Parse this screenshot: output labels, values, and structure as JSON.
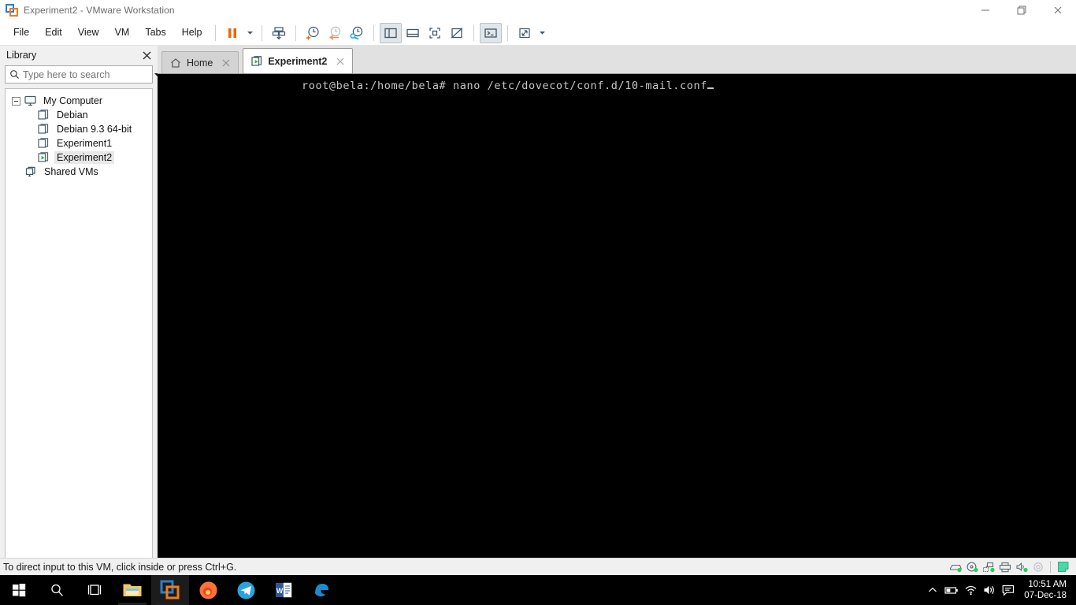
{
  "window": {
    "title": "Experiment2 - VMware Workstation",
    "app_icon": "vmware-logo-icon",
    "minimize_label": "Minimize",
    "restore_label": "Restore",
    "close_label": "Close"
  },
  "menubar": {
    "items": [
      {
        "label": "File",
        "name": "menu-file"
      },
      {
        "label": "Edit",
        "name": "menu-edit"
      },
      {
        "label": "View",
        "name": "menu-view"
      },
      {
        "label": "VM",
        "name": "menu-vm"
      },
      {
        "label": "Tabs",
        "name": "menu-tabs"
      },
      {
        "label": "Help",
        "name": "menu-help"
      }
    ]
  },
  "toolbar": {
    "buttons": [
      {
        "name": "suspend-button",
        "icon": "pause-icon",
        "tooltip": "Suspend this virtual machine"
      },
      {
        "name": "power-dropdown",
        "icon": "chevron-down-icon",
        "tooltip": "Power options"
      },
      {
        "name": "send-ctrl-alt-del-button",
        "icon": "send-keys-icon",
        "tooltip": "Send Ctrl+Alt+Delete"
      },
      {
        "name": "take-snapshot-button",
        "icon": "snapshot-add-icon",
        "tooltip": "Take a snapshot"
      },
      {
        "name": "revert-snapshot-button",
        "icon": "snapshot-revert-icon",
        "tooltip": "Revert to snapshot"
      },
      {
        "name": "manage-snapshots-button",
        "icon": "snapshot-manage-icon",
        "tooltip": "Manage snapshots"
      },
      {
        "name": "show-library-button",
        "icon": "panel-left-icon",
        "tooltip": "Show or hide the library"
      },
      {
        "name": "show-thumbnail-bar-button",
        "icon": "panel-bottom-icon",
        "tooltip": "Show or hide thumbnail bar"
      },
      {
        "name": "fullscreen-button",
        "icon": "fullscreen-icon",
        "tooltip": "Enter full screen mode"
      },
      {
        "name": "unity-mode-button",
        "icon": "unity-icon",
        "tooltip": "Unity mode"
      },
      {
        "name": "console-view-button",
        "icon": "console-icon",
        "tooltip": "Console view"
      },
      {
        "name": "stretch-guest-button",
        "icon": "stretch-icon",
        "tooltip": "Stretch guest display"
      },
      {
        "name": "stretch-dropdown",
        "icon": "chevron-down-icon",
        "tooltip": "Display options"
      }
    ]
  },
  "sidebar": {
    "title": "Library",
    "close_icon": "close-icon",
    "search": {
      "placeholder": "Type here to search",
      "value": "",
      "icon": "search-icon",
      "caret_icon": "chevron-down-icon"
    },
    "tree": [
      {
        "label": "My Computer",
        "level": 0,
        "icon": "monitor-icon",
        "expander": true,
        "selected": false,
        "name": "tree-item-my-computer"
      },
      {
        "label": "Debian",
        "level": 1,
        "icon": "vm-icon",
        "expander": false,
        "selected": false,
        "name": "tree-item-debian"
      },
      {
        "label": "Debian 9.3 64-bit",
        "level": 1,
        "icon": "vm-icon",
        "expander": false,
        "selected": false,
        "name": "tree-item-debian-93-64-bit"
      },
      {
        "label": "Experiment1",
        "level": 1,
        "icon": "vm-icon",
        "expander": false,
        "selected": false,
        "name": "tree-item-experiment1"
      },
      {
        "label": "Experiment2",
        "level": 1,
        "icon": "vm-running-icon",
        "expander": false,
        "selected": true,
        "name": "tree-item-experiment2"
      },
      {
        "label": "Shared VMs",
        "level": 0.5,
        "icon": "shared-vms-icon",
        "expander": false,
        "selected": false,
        "name": "tree-item-shared-vms"
      }
    ]
  },
  "tabs": [
    {
      "label": "Home",
      "icon": "home-icon",
      "active": false,
      "close_icon": "close-icon",
      "name": "tab-home"
    },
    {
      "label": "Experiment2",
      "icon": "vm-running-icon",
      "active": true,
      "close_icon": "close-icon",
      "name": "tab-experiment2"
    }
  ],
  "console": {
    "prompt": "root@bela:/home/bela# nano /etc/dovecot/conf.d/10-mail.conf",
    "cursor": "block",
    "background": "#000000",
    "foreground": "#c8c8c8"
  },
  "statusbar": {
    "message": "To direct input to this VM, click inside or press Ctrl+G.",
    "devices": [
      {
        "name": "hard-disk-status-icon",
        "icon": "hard-disk-icon",
        "connected": true
      },
      {
        "name": "cd-dvd-status-icon",
        "icon": "cd-dvd-icon",
        "connected": true
      },
      {
        "name": "network-adapter-status-icon",
        "icon": "network-icon",
        "connected": true
      },
      {
        "name": "printer-status-icon",
        "icon": "printer-icon",
        "connected": false
      },
      {
        "name": "sound-card-status-icon",
        "icon": "sound-icon",
        "connected": true
      },
      {
        "name": "usb-status-icon",
        "icon": "usb-disc-icon",
        "connected": false
      }
    ],
    "message_indicator": {
      "name": "message-log-icon",
      "color": "#4ad8a8"
    }
  },
  "taskbar": {
    "start": {
      "name": "start-button",
      "icon": "windows-logo-icon"
    },
    "search": {
      "name": "search-taskbar-button",
      "icon": "search-icon"
    },
    "task_view": {
      "name": "task-view-button",
      "icon": "task-view-icon"
    },
    "apps": [
      {
        "name": "taskbar-file-explorer",
        "icon": "folder-icon",
        "label": "File Explorer",
        "running": true,
        "active": false
      },
      {
        "name": "taskbar-vmware-workstation",
        "icon": "vmware-logo-icon",
        "label": "VMware Workstation",
        "running": true,
        "active": true
      },
      {
        "name": "taskbar-firefox",
        "icon": "firefox-icon",
        "label": "Firefox",
        "running": false,
        "active": false
      },
      {
        "name": "taskbar-telegram",
        "icon": "telegram-icon",
        "label": "Telegram",
        "running": false,
        "active": false
      },
      {
        "name": "taskbar-word",
        "icon": "word-icon",
        "label": "Microsoft Word",
        "running": false,
        "active": false
      },
      {
        "name": "taskbar-edge",
        "icon": "edge-icon",
        "label": "Microsoft Edge",
        "running": false,
        "active": false
      }
    ],
    "tray": [
      {
        "name": "show-hidden-icons-button",
        "icon": "chevron-up-icon"
      },
      {
        "name": "battery-status-icon",
        "icon": "battery-icon"
      },
      {
        "name": "network-status-icon",
        "icon": "wifi-icon"
      },
      {
        "name": "volume-status-icon",
        "icon": "speaker-icon"
      },
      {
        "name": "action-center-button",
        "icon": "notification-icon"
      }
    ],
    "clock": {
      "time": "10:51 AM",
      "date": "07-Dec-18"
    }
  },
  "colors": {
    "accent_orange": "#e8670c",
    "vmware_blue": "#28485d",
    "snapshot_teal": "#1fb6c9",
    "running_green": "#2bb32b",
    "console_bg": "#000000",
    "chrome_gray": "#f0f0f0",
    "tabstrip_gray": "#e1e1e1"
  }
}
